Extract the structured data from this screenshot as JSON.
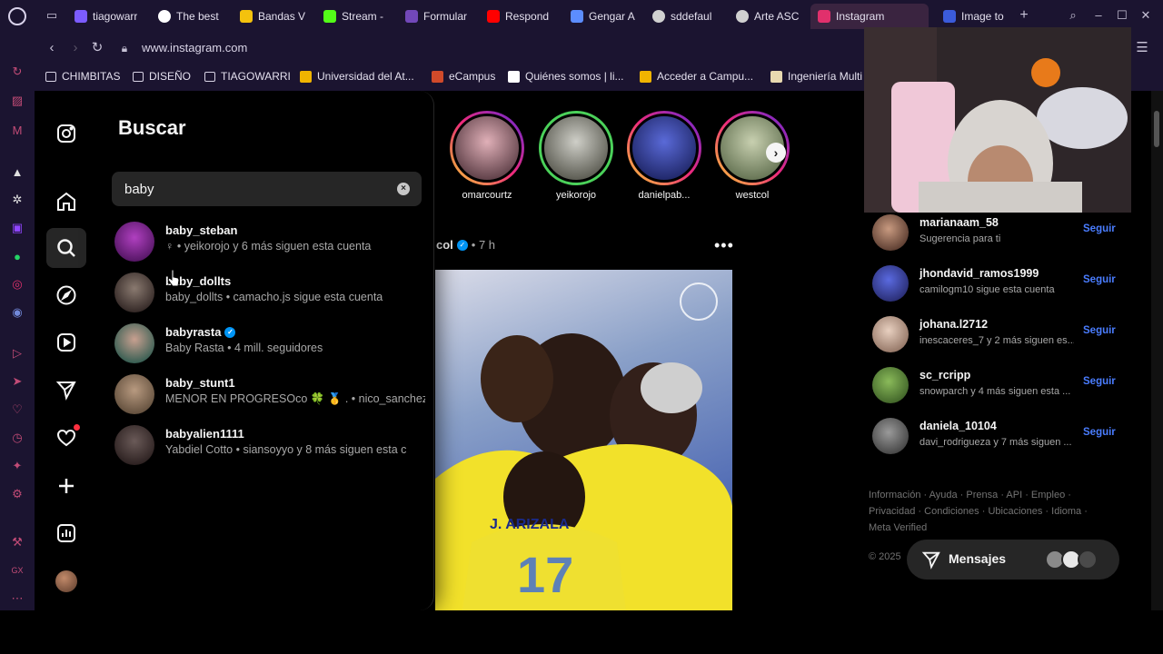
{
  "browser": {
    "tabs": [
      {
        "label": "tiagowarr",
        "color": "#7c5cff"
      },
      {
        "label": "The best",
        "color": "#ffffff"
      },
      {
        "label": "Bandas V",
        "color": "#f4c20d"
      },
      {
        "label": "Stream -",
        "color": "#53fc18"
      },
      {
        "label": "Formular",
        "color": "#7248b9"
      },
      {
        "label": "Respond",
        "color": "#ff0000"
      },
      {
        "label": "Gengar A",
        "color": "#5c8dff"
      },
      {
        "label": "sddefaul",
        "color": "#d0d0d0"
      },
      {
        "label": "Arte ASC",
        "color": "#d0d0d0"
      },
      {
        "label": "Instagram",
        "color": "#e1306c"
      },
      {
        "label": "Image to",
        "color": "#3b5bdb"
      }
    ],
    "new_tab": "+",
    "url": "www.instagram.com",
    "bookmarks": [
      {
        "label": "CHIMBITAS",
        "type": "folder"
      },
      {
        "label": "DISEÑO",
        "type": "folder"
      },
      {
        "label": "TIAGOWARRI",
        "type": "folder"
      },
      {
        "label": "Universidad del At...",
        "type": "site",
        "color": "#f0b400"
      },
      {
        "label": "eCampus",
        "type": "site",
        "color": "#d04a2a"
      },
      {
        "label": "Quiénes somos | li...",
        "type": "site",
        "color": "#ffffff"
      },
      {
        "label": "Acceder a Campu...",
        "type": "site",
        "color": "#f0b400"
      },
      {
        "label": "Ingeniería Multi",
        "type": "site",
        "color": "#e8d9b0"
      }
    ]
  },
  "search": {
    "title": "Buscar",
    "query": "baby",
    "clear_icon": "×",
    "results": [
      {
        "username": "baby_steban",
        "verified": false,
        "subtitle": "♀ • yeikorojo y 6 más siguen esta cuenta",
        "avatar_color": "#7a1c8a"
      },
      {
        "username": "baby_dollts",
        "verified": false,
        "subtitle": "baby_dollts • camacho.js sigue esta cuenta",
        "avatar_color": "#4a4040"
      },
      {
        "username": "babyrasta",
        "verified": true,
        "subtitle": "Baby Rasta • 4 mill. seguidores",
        "avatar_color": "#1f5a52"
      },
      {
        "username": "baby_stunt1",
        "verified": false,
        "subtitle": "MENOR EN PROGRESOco 🍀 🥇 . • nico_sanchez",
        "avatar_color": "#6b5a4a"
      },
      {
        "username": "babyalien1111",
        "verified": false,
        "subtitle": "Yabdiel Cotto • siansoyyo y 8 más siguen esta c",
        "avatar_color": "#3a3030"
      }
    ]
  },
  "stories": [
    {
      "name": "omarcourtz",
      "ring": "#d6249f",
      "color": "#b07a8a"
    },
    {
      "name": "yeikorojo",
      "ring": "#4bd15a",
      "color": "#6a6a5a"
    },
    {
      "name": "danielpab...",
      "ring": "#d6249f",
      "color": "#2a3a9a"
    },
    {
      "name": "westcol",
      "ring": "#d6249f",
      "color": "#8a9a7a"
    }
  ],
  "story_next": "›",
  "post": {
    "author_partial": "col",
    "verified": true,
    "time": "• 7 h",
    "more": "•••"
  },
  "suggestions": [
    {
      "user": "marianaam_58",
      "sub": "Sugerencia para ti",
      "follow": "Seguir",
      "color": "#6a4a3a"
    },
    {
      "user": "jhondavid_ramos1999",
      "sub": "camilogm10 sigue esta cuenta",
      "follow": "Seguir",
      "color": "#3a3aa0"
    },
    {
      "user": "johana.l2712",
      "sub": "inescaceres_7 y 2 más siguen es...",
      "follow": "Seguir",
      "color": "#c0a090"
    },
    {
      "user": "sc_rcripp",
      "sub": "snowparch y 4 más siguen esta ...",
      "follow": "Seguir",
      "color": "#3a7a2a"
    },
    {
      "user": "daniela_10104",
      "sub": "davi_rodrigueza y 7 más siguen ...",
      "follow": "Seguir",
      "color": "#5a5a5a"
    }
  ],
  "footer": {
    "line1": "Información · Ayuda · Prensa · API · Empleo ·",
    "line2": "Privacidad · Condiciones · Ubicaciones · Idioma ·",
    "line3": "Meta Verified",
    "copyright": "© 2025"
  },
  "messages": {
    "label": "Mensajes"
  }
}
